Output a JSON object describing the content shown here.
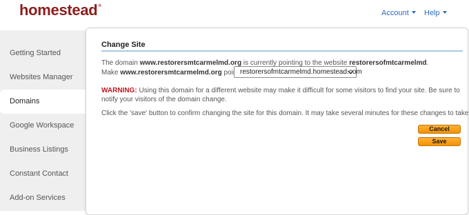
{
  "header": {
    "logo_text": "homestead",
    "logo_mark": "®",
    "account_label": "Account",
    "help_label": "Help"
  },
  "sidebar": {
    "items": [
      {
        "label": "Getting Started"
      },
      {
        "label": "Websites Manager"
      },
      {
        "label": "Domains"
      },
      {
        "label": "Google Workspace"
      },
      {
        "label": "Business Listings"
      },
      {
        "label": "Constant Contact"
      },
      {
        "label": "Add-on Services"
      }
    ],
    "active": "Domains"
  },
  "panel": {
    "title": "Change Site",
    "line1_pre": "The domain ",
    "line1_domain": "www.restorersmtcarmelmd.org",
    "line1_mid": " is currently pointing to the website ",
    "line1_site": "restorersofmtcarmelmd",
    "line1_end": ".",
    "line2_pre": "Make ",
    "line2_domain": "www.restorersmtcarmelmd.org",
    "line2_post": " point to",
    "select_value": "restorersofmtcarmelmd.homestead.com",
    "warning_label": "WARNING:",
    "warning_text": " Using this domain for a different website may make it difficult for some visitors to find your site. Be sure to notify your visitors of the domain change.",
    "instruction": "Click the 'save' button to confirm changing the site for this domain. It may take several minutes for these changes to take effect.",
    "cancel_label": "Cancel",
    "save_label": "Save"
  },
  "colors": {
    "brand": "#8b1d1d",
    "link": "#2a6bbf",
    "warning": "#c0161f",
    "button": "#f39200",
    "title_rule": "#a9c8e6"
  }
}
